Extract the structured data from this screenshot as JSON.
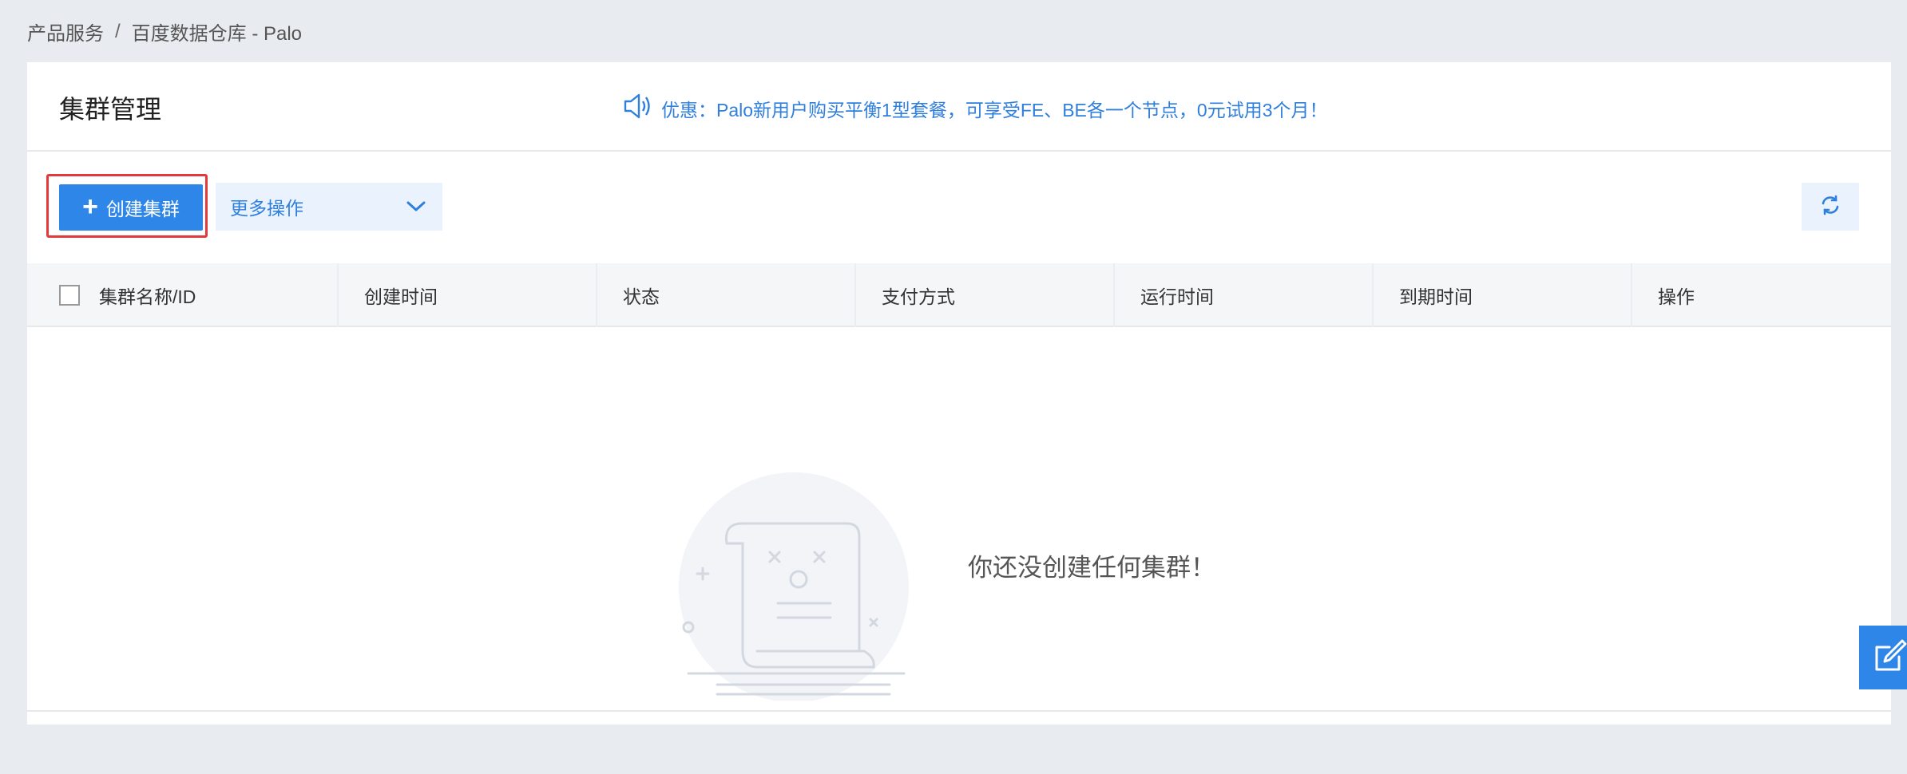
{
  "breadcrumb": {
    "items": [
      "产品服务",
      "百度数据仓库 - Palo"
    ],
    "separator": "/"
  },
  "header": {
    "title": "集群管理",
    "promo_icon": "speaker-icon",
    "promo_text": "优惠：Palo新用户购买平衡1型套餐，可享受FE、BE各一个节点，0元试用3个月！"
  },
  "toolbar": {
    "create_label": "创建集群",
    "more_label": "更多操作",
    "refresh_icon": "refresh-icon"
  },
  "table": {
    "columns": [
      "集群名称/ID",
      "创建时间",
      "状态",
      "支付方式",
      "运行时间",
      "到期时间",
      "操作"
    ]
  },
  "empty": {
    "message": "你还没创建任何集群！",
    "icon": "empty-scroll-icon"
  },
  "floating": {
    "icon": "edit-icon"
  },
  "colors": {
    "primary": "#2e86e8",
    "link": "#2f7fdc",
    "highlight_border": "#e03a3a",
    "page_bg": "#e8ebef"
  }
}
